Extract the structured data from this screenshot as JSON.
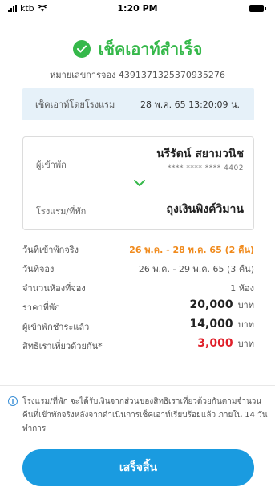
{
  "status_bar": {
    "carrier": "ktb",
    "time": "1:20 PM",
    "icons": [
      "signal-icon",
      "wifi-icon",
      "battery-icon"
    ]
  },
  "header": {
    "title": "เช็คเอาท์สำเร็จ",
    "icon": "check-circle-icon",
    "booking_number": "หมายเลขการจอง 4391371325370935276"
  },
  "checkout_info": {
    "label": "เช็คเอาท์โดยโรงแรม",
    "value": "28 พ.ค. 65 13:20:09 น."
  },
  "card": {
    "guest_label": "ผู้เข้าพัก",
    "guest_name": "นรีรัตน์ สยามวนิช",
    "guest_card": "**** **** **** 4402",
    "hotel_label": "โรงแรม/ที่พัก",
    "hotel_name": "ถุงเงินพิงค์วิมาน"
  },
  "details": [
    {
      "label": "วันที่เข้าพักจริง",
      "value": "26 พ.ค. - 28 พ.ค. 65 (2 คืน)"
    },
    {
      "label": "วันที่จอง",
      "value": "26 พ.ค. - 29 พ.ค. 65 (3 คืน)"
    },
    {
      "label": "จำนวนห้องที่จอง",
      "value": "1 ห้อง"
    }
  ],
  "amounts": [
    {
      "label": "ราคาที่พัก",
      "value": "20,000",
      "unit": "บาท"
    },
    {
      "label": "ผู้เข้าพักชำระแล้ว",
      "value": "14,000",
      "unit": "บาท"
    },
    {
      "label": "สิทธิเราเที่ยวด้วยกัน*",
      "value": "3,000",
      "unit": "บาท"
    }
  ],
  "note": "โรงแรม/ที่พัก จะได้รับเงินจากส่วนของสิทธิเราเที่ยวด้วยกันตามจำนวนคืนที่เข้าพักจริงหลังจากดำเนินการเช็คเอาท์เรียบร้อยแล้ว ภายใน 14 วันทำการ",
  "done_button": "เสร็จสิ้น",
  "colors": {
    "success": "#35b84a",
    "accent": "#1a9be0",
    "highlight": "#f08a1c",
    "subsidy": "#e0202a",
    "info_bg": "#e6f1f9"
  }
}
